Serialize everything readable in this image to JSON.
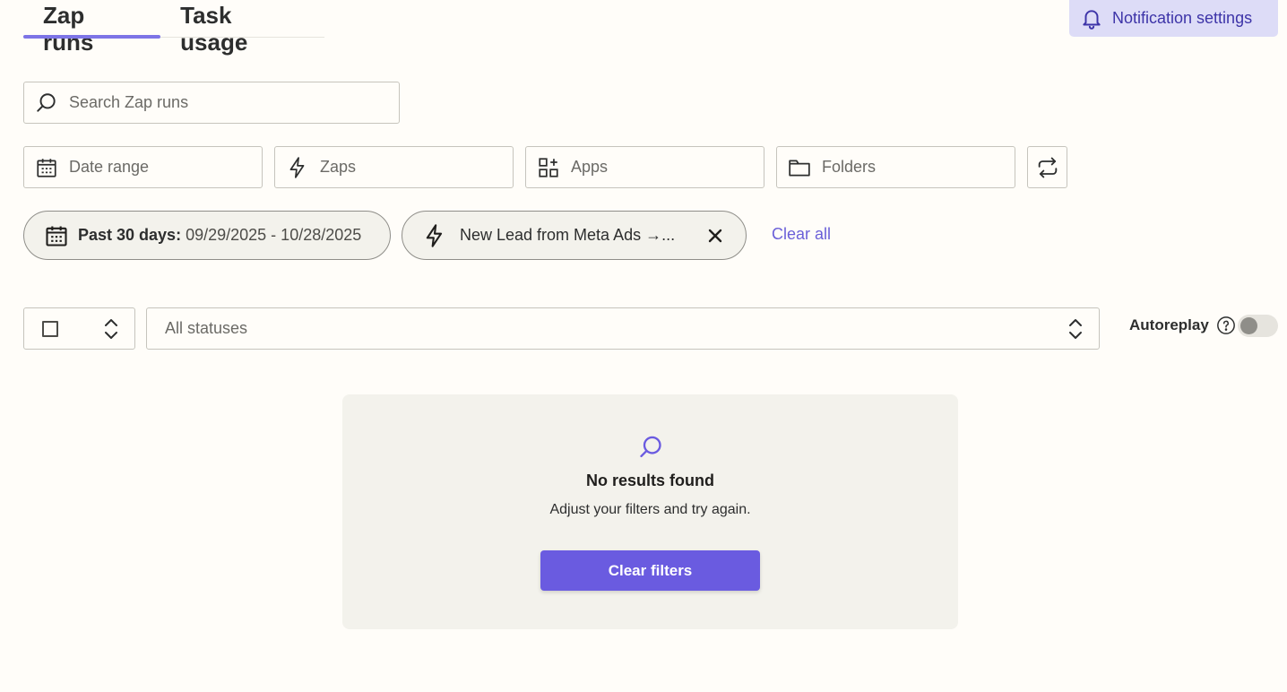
{
  "tabs": [
    {
      "label": "Zap runs",
      "active": true
    },
    {
      "label": "Task usage",
      "active": false
    }
  ],
  "notification_button": {
    "label": "Notification settings",
    "icon": "bell-icon"
  },
  "search": {
    "placeholder": "Search Zap runs",
    "value": ""
  },
  "filters": {
    "date_range": {
      "label": "Date range",
      "icon": "calendar-icon"
    },
    "zaps": {
      "label": "Zaps",
      "icon": "lightning-icon"
    },
    "apps": {
      "label": "Apps",
      "icon": "apps-icon"
    },
    "folders": {
      "label": "Folders",
      "icon": "folder-icon"
    },
    "refresh_icon": "refresh-icon"
  },
  "active_filters": {
    "date_chip": {
      "label": "Past 30 days:",
      "value": "09/29/2025 - 10/28/2025"
    },
    "zap_chip": {
      "label": "New Lead from Meta Ads →..."
    },
    "clear_all": "Clear all"
  },
  "status": {
    "select_all_checked": false,
    "status_value": "All statuses"
  },
  "autoreplay": {
    "label": "Autoreplay",
    "enabled": false
  },
  "empty_state": {
    "title": "No results found",
    "description": "Adjust your filters and try again.",
    "button": "Clear filters"
  },
  "colors": {
    "accent": "#6a5be0",
    "tab_underline": "#7d74e6",
    "notif_bg": "#dddcf7",
    "background": "#fffdf9",
    "panel": "#f3f2ec"
  }
}
